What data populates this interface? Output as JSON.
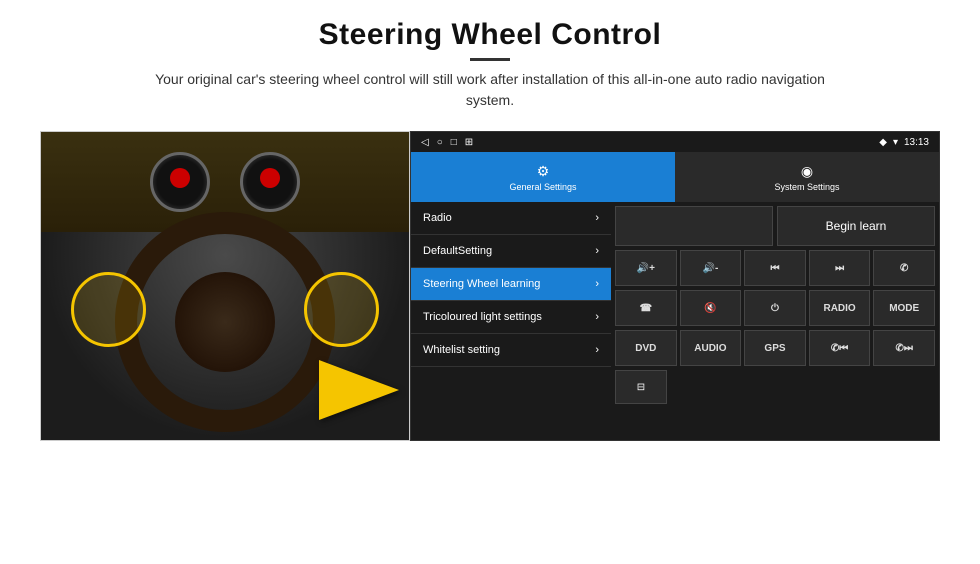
{
  "header": {
    "title": "Steering Wheel Control",
    "subtitle": "Your original car's steering wheel control will still work after installation of this all-in-one auto radio navigation system."
  },
  "status_bar": {
    "time": "13:13",
    "icons": [
      "◁",
      "○",
      "□",
      "⊞"
    ],
    "right_icons": [
      "⬧",
      "▾",
      "13:13"
    ]
  },
  "tabs": [
    {
      "label": "General Settings",
      "icon": "⚙",
      "active": true
    },
    {
      "label": "System Settings",
      "icon": "◉",
      "active": false
    }
  ],
  "menu_items": [
    {
      "label": "Radio",
      "active": false
    },
    {
      "label": "DefaultSetting",
      "active": false
    },
    {
      "label": "Steering Wheel learning",
      "active": true
    },
    {
      "label": "Tricoloured light settings",
      "active": false
    },
    {
      "label": "Whitelist setting",
      "active": false
    }
  ],
  "begin_learn_label": "Begin learn",
  "grid_row1": [
    {
      "icon": "🔊+",
      "text": "◀◀+"
    },
    {
      "icon": "🔊-",
      "text": "◀◀-"
    },
    {
      "icon": "⏮",
      "text": "⏮"
    },
    {
      "icon": "⏭",
      "text": "⏭"
    },
    {
      "icon": "📞",
      "text": "✆"
    }
  ],
  "grid_row2": [
    {
      "text": "☎"
    },
    {
      "text": "🔇"
    },
    {
      "text": "⏻"
    },
    {
      "text": "RADIO"
    },
    {
      "text": "MODE"
    }
  ],
  "grid_row3": [
    {
      "text": "DVD"
    },
    {
      "text": "AUDIO"
    },
    {
      "text": "GPS"
    },
    {
      "text": "✆⏮"
    },
    {
      "text": "✆⏭"
    }
  ],
  "grid_row4": [
    {
      "text": "⊟"
    }
  ]
}
